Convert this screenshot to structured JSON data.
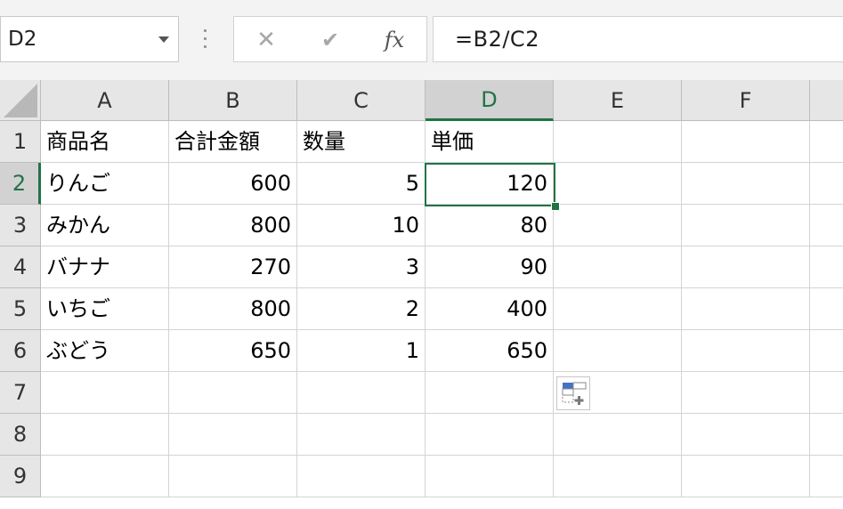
{
  "namebox": {
    "value": "D2"
  },
  "formula_bar": {
    "cancel_icon": "close-icon",
    "enter_icon": "check-icon",
    "fx_label": "fx",
    "formula": "=B2/C2"
  },
  "columns": [
    "A",
    "B",
    "C",
    "D",
    "E",
    "F"
  ],
  "rows": [
    "1",
    "2",
    "3",
    "4",
    "5",
    "6",
    "7",
    "8",
    "9"
  ],
  "selected_cell": {
    "column": "D",
    "row": "2"
  },
  "cells": {
    "A1": "商品名",
    "B1": "合計金額",
    "C1": "数量",
    "D1": "単価",
    "A2": "りんご",
    "B2": "600",
    "C2": "5",
    "D2": "120",
    "A3": "みかん",
    "B3": "800",
    "C3": "10",
    "D3": "80",
    "A4": "バナナ",
    "B4": "270",
    "C4": "3",
    "D4": "90",
    "A5": "いちご",
    "B5": "800",
    "C5": "2",
    "D5": "400",
    "A6": "ぶどう",
    "B6": "650",
    "C6": "1",
    "D6": "650"
  },
  "colors": {
    "accent": "#217346",
    "header_bg": "#e6e6e6",
    "header_selected_bg": "#d2d2d2",
    "gridline": "#d4d4d4"
  },
  "quick_analysis_icon": "quick-analysis-icon"
}
